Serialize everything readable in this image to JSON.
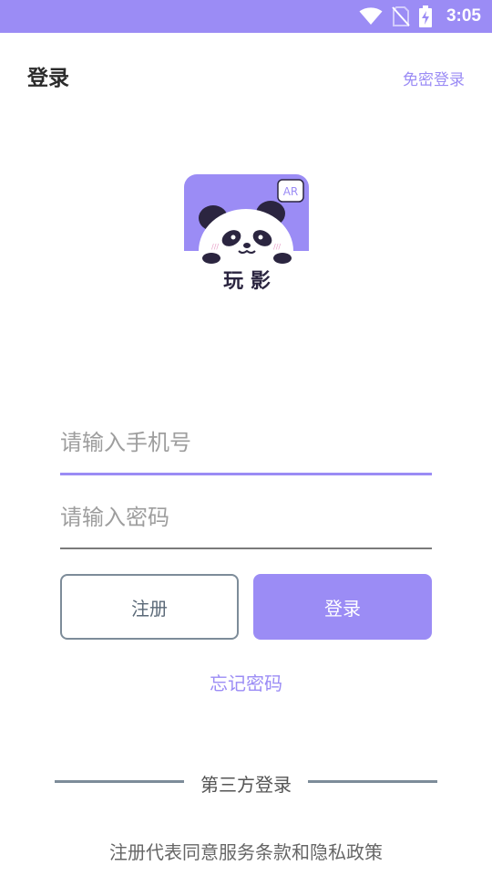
{
  "status_bar": {
    "time": "3:05",
    "icons": [
      "wifi-icon",
      "no-sim-icon",
      "battery-charging-icon"
    ],
    "color": "#9b8cf5"
  },
  "header": {
    "title": "登录",
    "password_free_login": "免密登录"
  },
  "logo": {
    "badge": "AR",
    "app_name": "玩 影"
  },
  "form": {
    "phone_placeholder": "请输入手机号",
    "password_placeholder": "请输入密码",
    "register_label": "注册",
    "login_label": "登录",
    "forgot_password": "忘记密码"
  },
  "third_party": {
    "label": "第三方登录"
  },
  "footer": {
    "terms": "注册代表同意服务条款和隐私政策"
  },
  "colors": {
    "accent": "#9b8cf5",
    "button_border": "#7d8c99"
  }
}
